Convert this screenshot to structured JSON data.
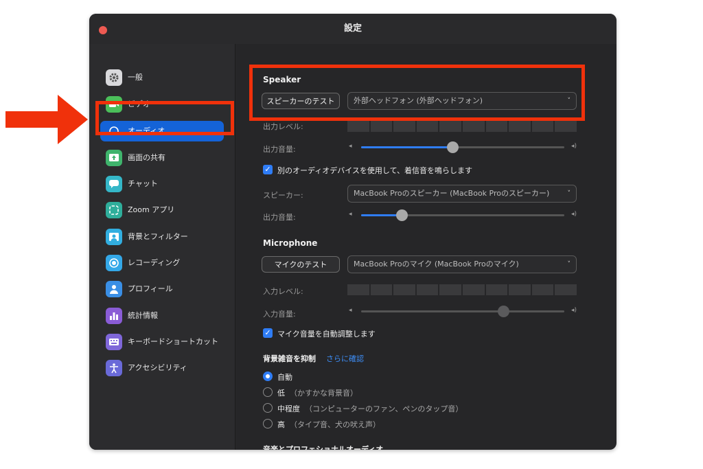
{
  "window": {
    "title": "設定"
  },
  "sidebar": {
    "items": [
      {
        "label": "一般",
        "icon": "gear-icon",
        "color": "#d9d9dc"
      },
      {
        "label": "ビデオ",
        "icon": "video-camera-icon",
        "color": "#4bbf5a"
      },
      {
        "label": "オーディオ",
        "icon": "headphones-icon",
        "color": "#1463d8",
        "active": true
      },
      {
        "label": "画面の共有",
        "icon": "share-screen-icon",
        "color": "#3fb46c"
      },
      {
        "label": "チャット",
        "icon": "chat-bubble-icon",
        "color": "#35b7c8"
      },
      {
        "label": "Zoom アプリ",
        "icon": "zoom-apps-icon",
        "color": "#2fae9b"
      },
      {
        "label": "背景とフィルター",
        "icon": "background-icon",
        "color": "#32aee0"
      },
      {
        "label": "レコーディング",
        "icon": "record-icon",
        "color": "#34a8e8"
      },
      {
        "label": "プロフィール",
        "icon": "profile-icon",
        "color": "#3a8fe6"
      },
      {
        "label": "統計情報",
        "icon": "stats-icon",
        "color": "#8a5cd6"
      },
      {
        "label": "キーボードショートカット",
        "icon": "keyboard-icon",
        "color": "#7f67d9"
      },
      {
        "label": "アクセシビリティ",
        "icon": "accessibility-icon",
        "color": "#6a6ad8"
      }
    ]
  },
  "speaker": {
    "heading": "Speaker",
    "test_button": "スピーカーのテスト",
    "device": "外部ヘッドフォン (外部ヘッドフォン)",
    "output_level_label": "出力レベル:",
    "output_volume_label": "出力音量:",
    "volume": 0.45
  },
  "ring": {
    "checkbox_label": "別のオーディオデバイスを使用して、着信音を鳴らします",
    "checked": true,
    "speaker_label": "スピーカー:",
    "device": "MacBook Proのスピーカー (MacBook Proのスピーカー)",
    "output_volume_label": "出力音量:",
    "volume": 0.2
  },
  "microphone": {
    "heading": "Microphone",
    "test_button": "マイクのテスト",
    "device": "MacBook Proのマイク (MacBook Proのマイク)",
    "input_level_label": "入力レベル:",
    "input_volume_label": "入力音量:",
    "volume": 0.7,
    "auto_adjust_label": "マイク音量を自動調整します",
    "auto_adjust_checked": true
  },
  "noise": {
    "heading": "背景雑音を抑制",
    "learn_more": "さらに確認",
    "options": [
      {
        "label": "自動",
        "desc": "",
        "selected": true
      },
      {
        "label": "低",
        "desc": "（かすかな背景音）",
        "selected": false
      },
      {
        "label": "中程度",
        "desc": "（コンピューターのファン、ペンのタップ音）",
        "selected": false
      },
      {
        "label": "高",
        "desc": "（タイプ音、犬の吠え声）",
        "selected": false
      }
    ]
  },
  "music": {
    "heading": "音楽とプロフェショナルオーディオ"
  },
  "colors": {
    "highlight": "#f0310b",
    "accent": "#2f7df6",
    "active_sidebar": "#1463d8"
  }
}
